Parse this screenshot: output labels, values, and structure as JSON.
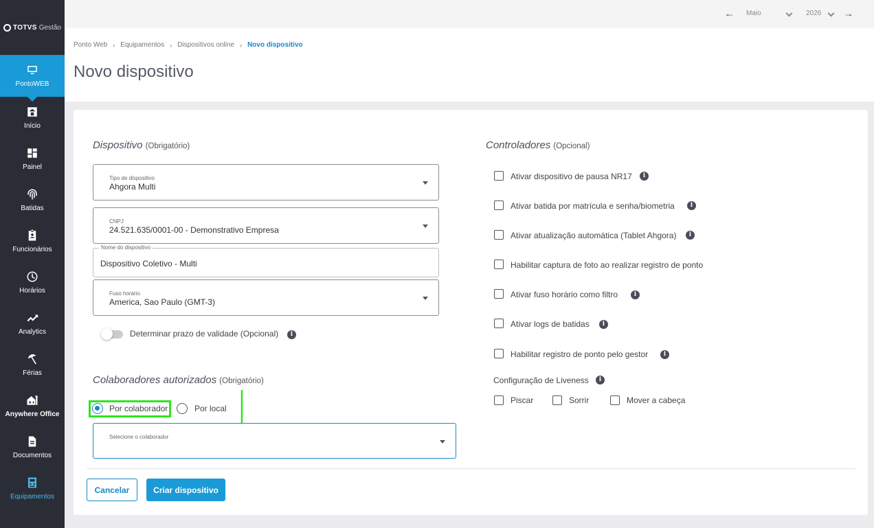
{
  "app": {
    "logo_text": "TOTVS",
    "logo_sub": "Gestão"
  },
  "sidebar": {
    "items": [
      {
        "label": "PontoWEB",
        "icon": "monitor-icon"
      },
      {
        "label": "Início",
        "icon": "home-icon"
      },
      {
        "label": "Painel",
        "icon": "dashboard-icon"
      },
      {
        "label": "Batidas",
        "icon": "fingerprint-icon"
      },
      {
        "label": "Funcionários",
        "icon": "badge-icon"
      },
      {
        "label": "Horários",
        "icon": "clock-icon"
      },
      {
        "label": "Analytics",
        "icon": "trending-icon"
      },
      {
        "label": "Férias",
        "icon": "umbrella-icon"
      },
      {
        "label": "Anywhere Office",
        "icon": "house-icon"
      },
      {
        "label": "Documentos",
        "icon": "document-icon"
      },
      {
        "label": "Equipamentos",
        "icon": "devices-icon"
      }
    ]
  },
  "topbar": {
    "month": "Maio",
    "year": "2026"
  },
  "breadcrumb": {
    "items": [
      "Ponto Web",
      "Equipamentos",
      "Dispositivos online"
    ],
    "current": "Novo dispositivo"
  },
  "page": {
    "title": "Novo dispositivo"
  },
  "dispositivo": {
    "title": "Dispositivo",
    "title_note": "(Obrigatório)",
    "tipo": {
      "label": "Tipo de dispositivo",
      "value": "Ahgora Multi"
    },
    "cnpj": {
      "label": "CNPJ",
      "value": "24.521.635/0001-00 - Demonstrativo Empresa"
    },
    "nome": {
      "label": "Nome do dispositivo",
      "value": "Dispositivo Coletivo - Multi"
    },
    "fuso": {
      "label": "Fuso horário",
      "value": "America, Sao Paulo (GMT-3)"
    },
    "validade_label": "Determinar prazo de validade (Opcional)"
  },
  "colaboradores": {
    "title": "Colaboradores autorizados",
    "title_note": "(Obrigatório)",
    "radio_colaborador": "Por colaborador",
    "radio_local": "Por local",
    "select_label": "Selecione o colaborador"
  },
  "controladores": {
    "title": "Controladores",
    "title_note": "(Opcional)",
    "options": [
      "Ativar dispositivo de pausa NR17",
      "Ativar batida por matrícula e senha/biometria",
      "Ativar atualização automática (Tablet Ahgora)",
      "Habilitar captura de foto ao realizar registro de ponto",
      "Ativar fuso horário como filtro",
      "Ativar logs de batidas",
      "Habilitar registro de ponto pelo gestor"
    ],
    "liveness_label": "Configuração de Liveness",
    "liveness_options": [
      "Piscar",
      "Sorrir",
      "Mover a cabeça"
    ]
  },
  "actions": {
    "cancel": "Cancelar",
    "create": "Criar dispositivo"
  },
  "colors": {
    "accent": "#1a9ad6",
    "sidebar": "#2a2d35",
    "highlight": "#2ee51f"
  }
}
